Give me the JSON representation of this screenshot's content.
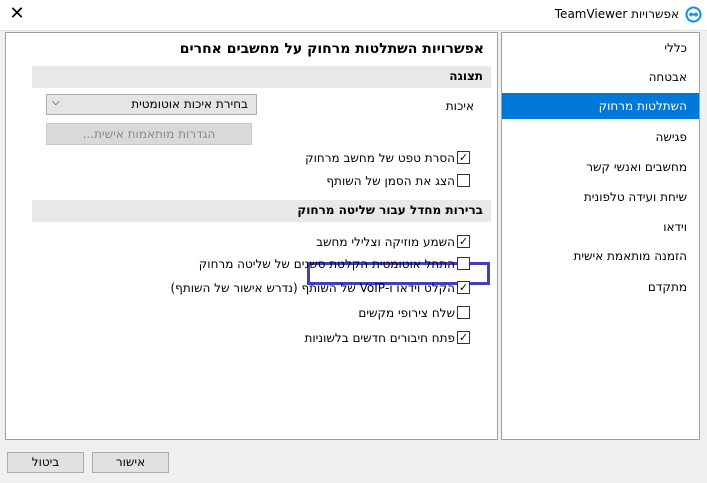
{
  "window": {
    "title": "TeamViewer אפשרויות",
    "close_glyph": "✕",
    "icon": "teamviewer-logo-icon"
  },
  "sidebar": {
    "items": [
      {
        "label": "כללי"
      },
      {
        "label": "אבטחה"
      },
      {
        "label": "השתלטות מרחוק",
        "selected": true
      },
      {
        "label": "פגישה"
      },
      {
        "label": "מחשבים ואנשי קשר"
      },
      {
        "label": "שיחת ועידה טלפונית"
      },
      {
        "label": "וידאו"
      },
      {
        "label": "הזמנה מותאמת אישית"
      },
      {
        "label": "מתקדם"
      }
    ]
  },
  "main": {
    "title": "אפשרויות השתלטות מרחוק על מחשבים אחרים",
    "display_section": {
      "title": "תצוגה",
      "quality_label": "איכות",
      "quality_value": "בחירת איכות אוטומטית",
      "custom_settings_button": "הגדרות מותאמות אישית...",
      "options": [
        {
          "label": "הסרת טפט של מחשב מרחוק",
          "checked": true
        },
        {
          "label": "הצג את הסמן של השותף",
          "checked": false
        }
      ]
    },
    "defaults_section": {
      "title": "ברירות מחדל עבור שליטה מרחוק",
      "options": [
        {
          "label": "השמע מוזיקה וצלילי מחשב",
          "checked": true
        },
        {
          "label": "התחל אוטומטית הקלטת סשנים של שליטה מרחוק",
          "checked": false
        },
        {
          "label": "הקלט וידאו ו-VoIP של השותף (נדרש אישור של השותף)",
          "checked": true
        },
        {
          "label": "שלח צירופי מקשים",
          "checked": false
        },
        {
          "label": "פתח חיבורים חדשים בלשוניות",
          "checked": true
        }
      ]
    }
  },
  "footer": {
    "ok_label": "אישור",
    "cancel_label": "ביטול"
  },
  "colors": {
    "selection": "#0078d7",
    "highlight_box": "#3f3fbf",
    "teamviewer_blue": "#0e8ee9"
  }
}
